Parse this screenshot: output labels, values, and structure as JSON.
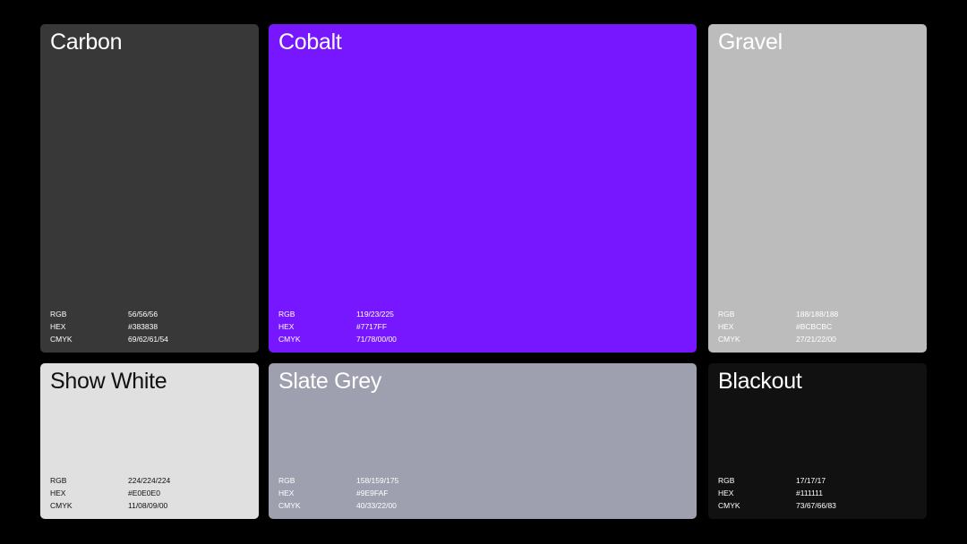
{
  "swatches": [
    {
      "name": "Carbon",
      "bg": "#383838",
      "fg": "#ffffff",
      "specs": [
        {
          "label": "RGB",
          "value": "56/56/56"
        },
        {
          "label": "HEX",
          "value": "#383838"
        },
        {
          "label": "CMYK",
          "value": "69/62/61/54"
        }
      ]
    },
    {
      "name": "Cobalt",
      "bg": "#7717FF",
      "fg": "#ffffff",
      "specs": [
        {
          "label": "RGB",
          "value": "119/23/225"
        },
        {
          "label": "HEX",
          "value": "#7717FF"
        },
        {
          "label": "CMYK",
          "value": "71/78/00/00"
        }
      ]
    },
    {
      "name": "Gravel",
      "bg": "#BCBCBC",
      "fg": "#ffffff",
      "specs": [
        {
          "label": "RGB",
          "value": "188/188/188"
        },
        {
          "label": "HEX",
          "value": "#BCBCBC"
        },
        {
          "label": "CMYK",
          "value": "27/21/22/00"
        }
      ]
    },
    {
      "name": "Show White",
      "bg": "#E0E0E0",
      "fg": "#111111",
      "specs": [
        {
          "label": "RGB",
          "value": "224/224/224"
        },
        {
          "label": "HEX",
          "value": "#E0E0E0"
        },
        {
          "label": "CMYK",
          "value": "11/08/09/00"
        }
      ]
    },
    {
      "name": "Slate Grey",
      "bg": "#9E9FAF",
      "fg": "#ffffff",
      "specs": [
        {
          "label": "RGB",
          "value": "158/159/175"
        },
        {
          "label": "HEX",
          "value": "#9E9FAF"
        },
        {
          "label": "CMYK",
          "value": "40/33/22/00"
        }
      ]
    },
    {
      "name": "Blackout",
      "bg": "#111111",
      "fg": "#ffffff",
      "specs": [
        {
          "label": "RGB",
          "value": "17/17/17"
        },
        {
          "label": "HEX",
          "value": "#111111"
        },
        {
          "label": "CMYK",
          "value": "73/67/66/83"
        }
      ]
    }
  ]
}
